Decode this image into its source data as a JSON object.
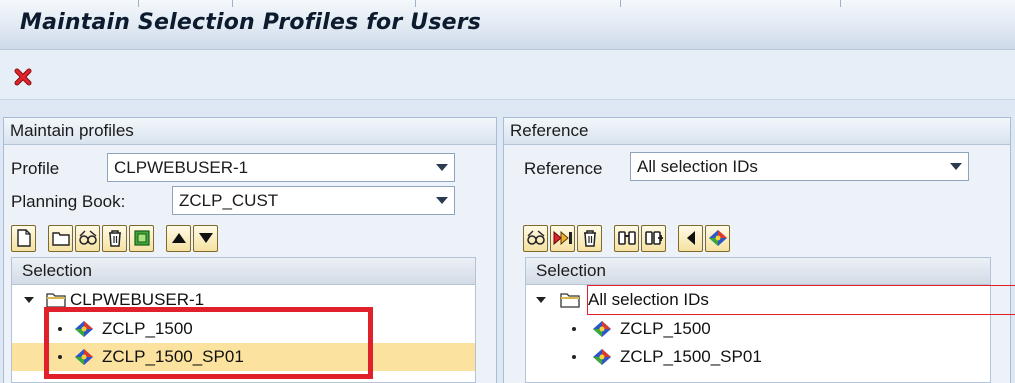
{
  "title": "Maintain Selection Profiles for Users",
  "colors": {
    "accent_red": "#e0202a",
    "selection_yellow": "#fbe29e",
    "button_gold": "#f5e1a0"
  },
  "toolbar": {
    "exit_icon": "red-x-icon"
  },
  "left_panel": {
    "header": "Maintain profiles",
    "profile_label": "Profile",
    "profile_value": "CLPWEBUSER-1",
    "planning_book_label": "Planning Book:",
    "planning_book_value": "ZCLP_CUST",
    "buttons": [
      "create-icon",
      "folder-icon",
      "glasses-icon",
      "delete-icon",
      "export-icon",
      "move-up-icon",
      "move-down-icon"
    ],
    "tree": {
      "header": "Selection",
      "root": "CLPWEBUSER-1",
      "items": [
        "ZCLP_1500",
        "ZCLP_1500_SP01"
      ],
      "selected_index": 1
    }
  },
  "right_panel": {
    "header": "Reference",
    "reference_label": "Reference",
    "reference_value": "All selection IDs",
    "buttons": [
      "glasses-icon",
      "transfer-icon",
      "delete-icon",
      "find-icon",
      "find-next-icon",
      "back-icon",
      "selection-icon"
    ],
    "tree": {
      "header": "Selection",
      "root": "All selection IDs",
      "items": [
        "ZCLP_1500",
        "ZCLP_1500_SP01"
      ]
    }
  }
}
